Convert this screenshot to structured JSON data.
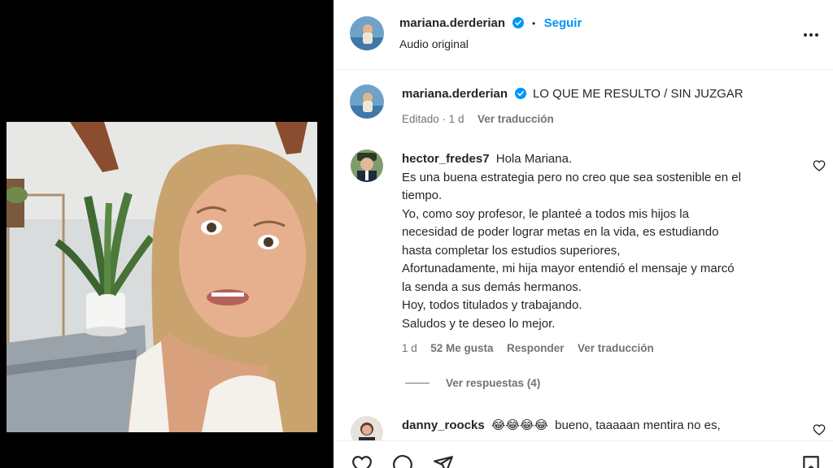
{
  "header": {
    "username": "mariana.derderian",
    "separator": "•",
    "follow_label": "Seguir",
    "audio_label": "Audio original",
    "more_icon": "more-horizontal-icon"
  },
  "caption": {
    "username": "mariana.derderian",
    "text": "LO QUE ME RESULTO / SIN JUZGAR",
    "meta_edited": "Editado · 1 d",
    "translate_label": "Ver traducción"
  },
  "comments": [
    {
      "username": "hector_fredes7",
      "first_line": "Hola Mariana.",
      "body": "Es una buena estrategia pero no creo que sea sostenible en el\ntiempo.\nYo, como soy profesor, le planteé a todos mis hijos la\nnecesidad de poder lograr metas en la vida, es estudiando\nhasta completar los estudios superiores,\nAfortunadamente, mi hija mayor entendió el mensaje y marcó\nla senda a sus demás hermanos.\nHoy, todos titulados y trabajando.\nSaludos y te deseo lo mejor.",
      "time": "1 d",
      "likes": "52 Me gusta",
      "reply_label": "Responder",
      "translate_label": "Ver traducción",
      "view_replies": "Ver respuestas (4)"
    },
    {
      "username": "danny_roocks",
      "emojis": "😂😂😂😂",
      "text": "bueno, taaaaan mentira no es,"
    }
  ],
  "actions": {
    "icons": [
      "heart-icon",
      "comment-icon",
      "share-icon",
      "save-icon"
    ]
  },
  "colors": {
    "accent": "#0095f6",
    "verified": "#0095f6",
    "muted": "#737373",
    "text": "#262626"
  }
}
